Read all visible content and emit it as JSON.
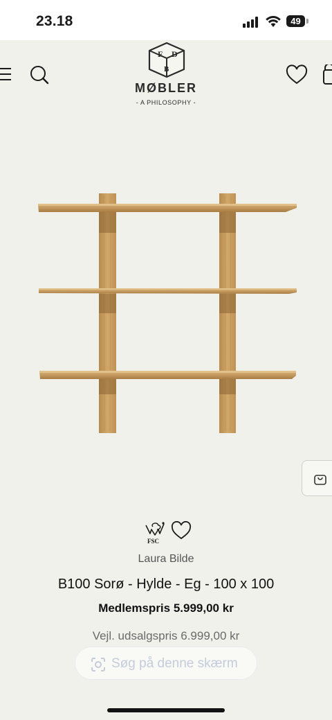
{
  "status_bar": {
    "time": "23.18",
    "battery": "49"
  },
  "header": {
    "brand_name": "MØBLER",
    "tagline": "- A PHILOSOPHY -",
    "logo_letters": [
      "F",
      "D",
      "B"
    ]
  },
  "product": {
    "badge_fsc": "FSC",
    "designer": "Laura Bilde",
    "title": "B100 Sorø - Hylde - Eg - 100 x 100",
    "member_price": "Medlemspris 5.999,00 kr",
    "rrp": "Vejl. udsalgspris 6.999,00 kr"
  },
  "overlay": {
    "lens_label": "Søg på denne skærm"
  },
  "icons": [
    "menu-icon",
    "search-icon",
    "heart-icon",
    "shopping-bag-icon",
    "fsc-icon",
    "lens-icon"
  ],
  "colors": {
    "background": "#f1f1ec",
    "oak": "#c99d5f",
    "text": "#1a1a1a"
  }
}
